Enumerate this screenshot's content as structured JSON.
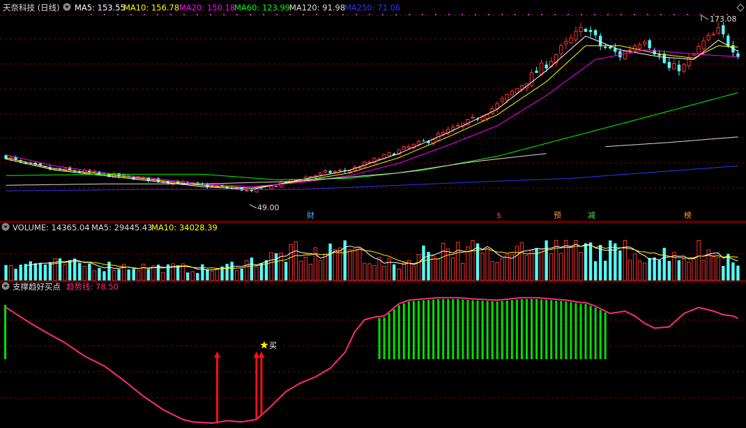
{
  "stock": {
    "title": "天奈科技 (日线)",
    "ma_labels": [
      {
        "text": "MA5: 153.55",
        "color": "#ffffff"
      },
      {
        "text": "MA10: 156.78",
        "color": "#ffff00"
      },
      {
        "text": "MA20: 150.18",
        "color": "#ff00ff"
      },
      {
        "text": "MA60: 123.99",
        "color": "#00ff00"
      },
      {
        "text": "MA120: 91.98",
        "color": "#dddddd"
      },
      {
        "text": "MA250: 71.06",
        "color": "#3333ff"
      }
    ],
    "high_label": "173.08",
    "low_label": "49.00",
    "event_markers": [
      {
        "text": "财",
        "color": "#55aaff"
      },
      {
        "text": "$",
        "color": "#ff3333"
      },
      {
        "text": "预",
        "color": "#ff9933"
      },
      {
        "text": "减",
        "color": "#55dd55"
      },
      {
        "text": "榜",
        "color": "#ff9933"
      }
    ]
  },
  "volume": {
    "label_volume": "VOLUME: 14365.04",
    "label_ma5": "MA5: 29445.43",
    "label_ma10": "MA10: 34028.39"
  },
  "indicator": {
    "name": "支撑趋好买点",
    "line_label": "趋势线: 78.50",
    "buy_label": "买"
  },
  "colors": {
    "up": "#ff3232",
    "down": "#54fcfc",
    "grid": "#8b0000",
    "trend": "#ff2a7f",
    "green_bar": "#00e000",
    "arrow": "#ff1010"
  },
  "chart_data": [
    {
      "type": "candlestick",
      "title": "天奈科技 (日线)",
      "y_range": [
        40,
        180
      ],
      "y_max_label": 173.08,
      "y_min_label": 49.0,
      "x_count": 150,
      "close_anchors": [
        [
          0,
          78
        ],
        [
          3,
          73
        ],
        [
          8,
          69
        ],
        [
          15,
          67
        ],
        [
          22,
          64
        ],
        [
          30,
          61
        ],
        [
          40,
          57
        ],
        [
          48,
          54
        ],
        [
          50,
          52
        ],
        [
          55,
          57
        ],
        [
          60,
          62
        ],
        [
          65,
          66
        ],
        [
          70,
          68
        ],
        [
          75,
          75
        ],
        [
          80,
          82
        ],
        [
          85,
          88
        ],
        [
          90,
          96
        ],
        [
          95,
          104
        ],
        [
          100,
          115
        ],
        [
          105,
          130
        ],
        [
          110,
          145
        ],
        [
          115,
          162
        ],
        [
          118,
          172
        ],
        [
          121,
          158
        ],
        [
          125,
          151
        ],
        [
          130,
          164
        ],
        [
          133,
          150
        ],
        [
          135,
          141
        ],
        [
          138,
          143
        ],
        [
          142,
          160
        ],
        [
          145,
          168
        ],
        [
          149,
          153
        ]
      ],
      "ma_anchors": {
        "MA5": [
          [
            0,
            76
          ],
          [
            10,
            68
          ],
          [
            20,
            64
          ],
          [
            30,
            60
          ],
          [
            40,
            56
          ],
          [
            50,
            54
          ],
          [
            60,
            61
          ],
          [
            70,
            68
          ],
          [
            80,
            80
          ],
          [
            90,
            95
          ],
          [
            100,
            112
          ],
          [
            110,
            140
          ],
          [
            118,
            165
          ],
          [
            125,
            155
          ],
          [
            133,
            150
          ],
          [
            140,
            148
          ],
          [
            145,
            162
          ],
          [
            149,
            154
          ]
        ],
        "MA10": [
          [
            0,
            77
          ],
          [
            10,
            69
          ],
          [
            20,
            65
          ],
          [
            30,
            61
          ],
          [
            40,
            57
          ],
          [
            50,
            55
          ],
          [
            60,
            60
          ],
          [
            70,
            66
          ],
          [
            80,
            77
          ],
          [
            90,
            92
          ],
          [
            100,
            108
          ],
          [
            110,
            132
          ],
          [
            118,
            158
          ],
          [
            125,
            158
          ],
          [
            133,
            152
          ],
          [
            140,
            149
          ],
          [
            145,
            158
          ],
          [
            149,
            157
          ]
        ],
        "MA20": [
          [
            0,
            79
          ],
          [
            10,
            71
          ],
          [
            20,
            66
          ],
          [
            30,
            62
          ],
          [
            40,
            58
          ],
          [
            50,
            56
          ],
          [
            60,
            59
          ],
          [
            70,
            64
          ],
          [
            80,
            73
          ],
          [
            90,
            86
          ],
          [
            100,
            100
          ],
          [
            110,
            122
          ],
          [
            120,
            148
          ],
          [
            130,
            155
          ],
          [
            140,
            152
          ],
          [
            149,
            150
          ]
        ],
        "MA60": [
          [
            0,
            64
          ],
          [
            20,
            65
          ],
          [
            40,
            65
          ],
          [
            55,
            61
          ],
          [
            70,
            62
          ],
          [
            85,
            68
          ],
          [
            100,
            78
          ],
          [
            115,
            92
          ],
          [
            130,
            106
          ],
          [
            149,
            124
          ]
        ],
        "MA120_seg1": [
          [
            0,
            57
          ],
          [
            20,
            58
          ],
          [
            40,
            58
          ],
          [
            60,
            60
          ],
          [
            80,
            66
          ],
          [
            95,
            74
          ],
          [
            110,
            80
          ]
        ],
        "MA120_seg2": [
          [
            122,
            85
          ],
          [
            135,
            88
          ],
          [
            149,
            92
          ]
        ],
        "MA250": [
          [
            0,
            53
          ],
          [
            30,
            54
          ],
          [
            60,
            54
          ],
          [
            80,
            57
          ],
          [
            100,
            60
          ],
          [
            115,
            62
          ],
          [
            130,
            66
          ],
          [
            149,
            71
          ]
        ]
      }
    },
    {
      "type": "bar",
      "title": "VOLUME",
      "values_last": 14365.04,
      "ma5_last": 29445.43,
      "ma10_last": 34028.39,
      "y_range": [
        0,
        70000
      ]
    },
    {
      "type": "line",
      "title": "支撑趋好买点",
      "y_range": [
        0,
        100
      ],
      "series": [
        {
          "name": "趋势线",
          "x": [
            0,
            5,
            8,
            12,
            16,
            20,
            24,
            28,
            32,
            36,
            38,
            42,
            45,
            48,
            51,
            54,
            57,
            60,
            63,
            66,
            69,
            71,
            73,
            75,
            77,
            80,
            82,
            85,
            88,
            92,
            95,
            100,
            105,
            108,
            111,
            114,
            117,
            118,
            120,
            123,
            126,
            128,
            130,
            132,
            135,
            138,
            141,
            144,
            146,
            148,
            149
          ],
          "y": [
            95,
            82,
            75,
            66,
            55,
            47,
            35,
            22,
            11,
            3,
            1,
            0,
            2,
            1,
            3,
            14,
            26,
            33,
            38,
            45,
            58,
            75,
            85,
            87,
            88,
            98,
            101,
            102,
            103,
            103,
            102,
            101,
            103,
            103,
            102,
            101,
            99,
            99,
            96,
            90,
            92,
            88,
            82,
            78,
            79,
            90,
            95,
            92,
            89,
            88,
            86
          ],
          "last": 78.5
        }
      ],
      "green_bar_range_x": [
        76,
        122
      ],
      "green_bar_first_x": 0,
      "red_arrows_x": [
        43,
        51,
        52
      ],
      "buy_star_x": 52
    }
  ]
}
